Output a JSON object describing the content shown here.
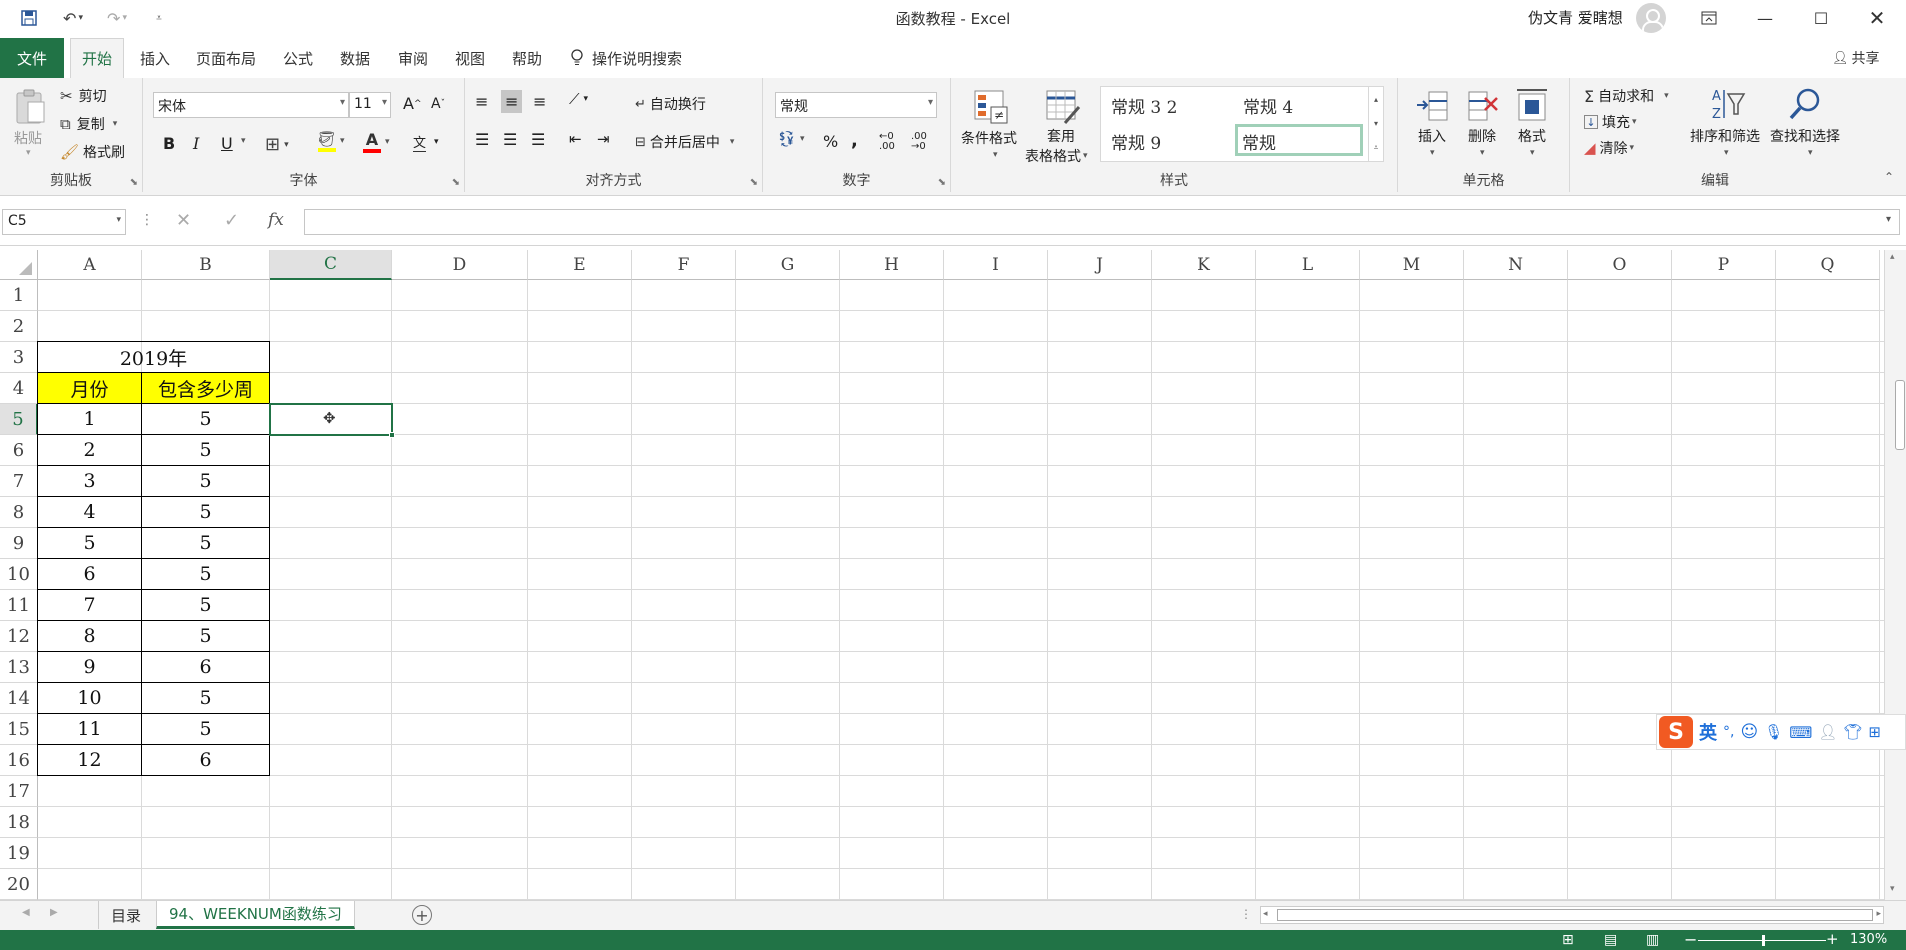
{
  "window": {
    "title": "函数教程  -  Excel",
    "user": "伪文青 爱瞎想",
    "controls": [
      "ribbon-display-icon",
      "minimize-icon",
      "maximize-icon",
      "close-icon"
    ]
  },
  "quick_access": [
    "save-icon",
    "undo-icon",
    "redo-icon",
    "customize-qat-icon"
  ],
  "ribbon_tabs": {
    "file": "文件",
    "home": "开始",
    "insert": "插入",
    "page_layout": "页面布局",
    "formulas": "公式",
    "data": "数据",
    "review": "审阅",
    "view": "视图",
    "help": "帮助",
    "tell_me": "操作说明搜索",
    "share": "共享"
  },
  "clipboard": {
    "paste": "粘贴",
    "cut": "剪切",
    "copy": "复制",
    "format_painter": "格式刷",
    "label": "剪贴板"
  },
  "font": {
    "name": "宋体",
    "size": "11",
    "bold": "B",
    "italic": "I",
    "underline": "U",
    "label": "字体",
    "color_fill": "#ffff00",
    "color_font": "#ff0000"
  },
  "alignment": {
    "wrap": "自动换行",
    "merge": "合并后居中",
    "label": "对齐方式"
  },
  "number": {
    "format": "常规",
    "percent": "%",
    "comma": ",",
    "label": "数字"
  },
  "styles": {
    "conditional": "条件格式",
    "table_format_1": "套用",
    "table_format_2": "表格格式",
    "gallery": [
      "常规 3 2",
      "常规 4",
      "常规 9",
      "常规"
    ],
    "label": "样式"
  },
  "cells": {
    "insert": "插入",
    "delete": "删除",
    "format": "格式",
    "label": "单元格"
  },
  "editing": {
    "autosum": "自动求和",
    "fill": "填充",
    "clear": "清除",
    "sort_filter": "排序和筛选",
    "find_select": "查找和选择",
    "label": "编辑"
  },
  "formula_bar": {
    "name_box": "C5",
    "fx": "fx",
    "formula": ""
  },
  "columns": [
    "A",
    "B",
    "C",
    "D",
    "E",
    "F",
    "G",
    "H",
    "I",
    "J",
    "K",
    "L",
    "M",
    "N",
    "O",
    "P",
    "Q"
  ],
  "rows": [
    "1",
    "2",
    "3",
    "4",
    "5",
    "6",
    "7",
    "8",
    "9",
    "10",
    "11",
    "12",
    "13",
    "14",
    "15",
    "16",
    "17",
    "18",
    "19",
    "20"
  ],
  "sheet": {
    "year_header": "2019年",
    "col_month": "月份",
    "col_weeks": "包含多少周",
    "months": [
      "1",
      "2",
      "3",
      "4",
      "5",
      "6",
      "7",
      "8",
      "9",
      "10",
      "11",
      "12"
    ],
    "weeks": [
      "5",
      "5",
      "5",
      "5",
      "5",
      "5",
      "5",
      "5",
      "6",
      "5",
      "5",
      "6"
    ],
    "header_color": "#ffff00",
    "selected_cell": "C5"
  },
  "sheet_tabs": [
    "目录",
    "94、WEEKNUM函数练习"
  ],
  "status": {
    "zoom": "130%"
  },
  "ime": {
    "lang": "英"
  },
  "accent": "#217346"
}
